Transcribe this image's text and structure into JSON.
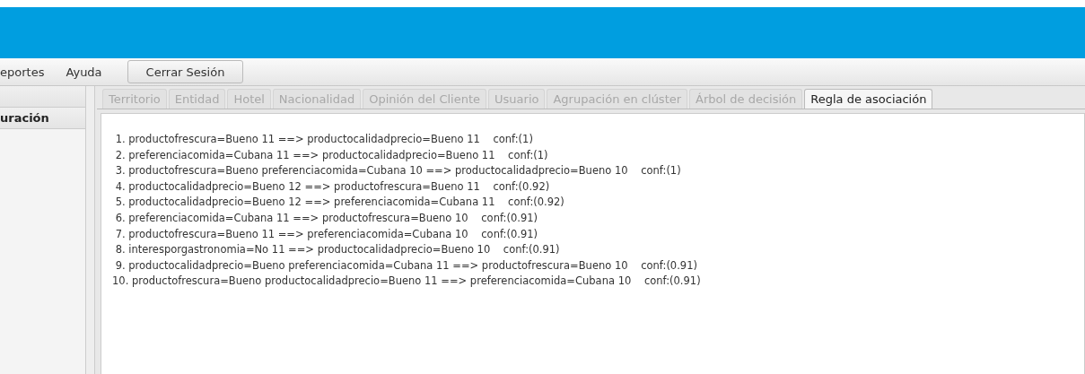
{
  "menu": [
    "eportes",
    "Ayuda"
  ],
  "logout_button": "Cerrar Sesión",
  "sidebar": {
    "items": [
      {
        "label": "uración",
        "selected": true
      }
    ]
  },
  "tabs": [
    {
      "label": "Territorio",
      "selected": false
    },
    {
      "label": "Entidad",
      "selected": false
    },
    {
      "label": "Hotel",
      "selected": false
    },
    {
      "label": "Nacionalidad",
      "selected": false
    },
    {
      "label": "Opinión del Cliente",
      "selected": false
    },
    {
      "label": "Usuario",
      "selected": false
    },
    {
      "label": "Agrupación en clúster",
      "selected": false
    },
    {
      "label": "Árbol de decisión",
      "selected": false
    },
    {
      "label": "Regla de asociación",
      "selected": true
    }
  ],
  "rules": [
    " 1. productofrescura=Bueno 11 ==> productocalidadprecio=Bueno 11    conf:(1)",
    " 2. preferenciacomida=Cubana 11 ==> productocalidadprecio=Bueno 11    conf:(1)",
    " 3. productofrescura=Bueno preferenciacomida=Cubana 10 ==> productocalidadprecio=Bueno 10    conf:(1)",
    " 4. productocalidadprecio=Bueno 12 ==> productofrescura=Bueno 11    conf:(0.92)",
    " 5. productocalidadprecio=Bueno 12 ==> preferenciacomida=Cubana 11    conf:(0.92)",
    " 6. preferenciacomida=Cubana 11 ==> productofrescura=Bueno 10    conf:(0.91)",
    " 7. productofrescura=Bueno 11 ==> preferenciacomida=Cubana 10    conf:(0.91)",
    " 8. interesporgastronomia=No 11 ==> productocalidadprecio=Bueno 10    conf:(0.91)",
    " 9. productocalidadprecio=Bueno preferenciacomida=Cubana 11 ==> productofrescura=Bueno 10    conf:(0.91)",
    "10. productofrescura=Bueno productocalidadprecio=Bueno 11 ==> preferenciacomida=Cubana 10    conf:(0.91)"
  ]
}
